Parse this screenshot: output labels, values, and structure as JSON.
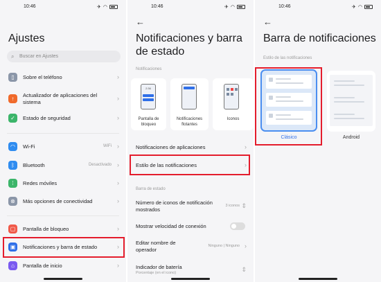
{
  "status": {
    "time": "10:46",
    "battery": "85"
  },
  "colors": {
    "accent": "#2f6fe8",
    "highlight": "#e41c2c"
  },
  "screen1": {
    "title": "Ajustes",
    "search_placeholder": "Buscar en Ajustes",
    "items": [
      {
        "label": "Sobre el teléfono",
        "icon": "phone-info-icon",
        "color": "#8b96a8",
        "value": ""
      },
      {
        "label": "Actualizador de aplicaciones del sistema",
        "icon": "update-arrow-icon",
        "color": "#f06a2b",
        "value": ""
      },
      {
        "label": "Estado de seguridad",
        "icon": "shield-check-icon",
        "color": "#3cb56a",
        "value": ""
      },
      {
        "label": "Wi-Fi",
        "icon": "wifi-icon",
        "color": "#2f8cf0",
        "value": "WiFi"
      },
      {
        "label": "Bluetooth",
        "icon": "bluetooth-icon",
        "color": "#2f8cf0",
        "value": "Desactivado"
      },
      {
        "label": "Redes móviles",
        "icon": "mobile-network-icon",
        "color": "#3cb56a",
        "value": ""
      },
      {
        "label": "Más opciones de conectividad",
        "icon": "connectivity-icon",
        "color": "#8b96a8",
        "value": ""
      },
      {
        "label": "Pantalla de bloqueo",
        "icon": "lock-screen-icon",
        "color": "#f05a4a",
        "value": ""
      },
      {
        "label": "Notificaciones y barra de estado",
        "icon": "notification-icon",
        "color": "#2f6fe8",
        "value": ""
      },
      {
        "label": "Pantalla de inicio",
        "icon": "home-screen-icon",
        "color": "#7a5af0",
        "value": ""
      }
    ]
  },
  "screen2": {
    "title": "Notificaciones y barra de estado",
    "section_notif": "Notificaciones",
    "cards": [
      {
        "label": "Pantalla de bloqueo"
      },
      {
        "label": "Notificaciones flotantes"
      },
      {
        "label": "Iconos"
      }
    ],
    "lock_card_time": "2:36",
    "row_apps": "Notificaciones de aplicaciones",
    "row_style": "Estilo de las notificaciones",
    "section_status": "Barra de estado",
    "row_icons": "Número de iconos de notificación mostrados",
    "row_icons_value": "3 iconos",
    "row_speed": "Mostrar velocidad de conexión",
    "row_operator": "Editar nombre de operador",
    "row_operator_value": "Ninguno | Ninguno",
    "row_battery": "Indicador de batería",
    "row_battery_sub": "Porcentaje (en el icono)"
  },
  "screen3": {
    "title": "Barra de notificaciones",
    "section": "Estilo de las notificaciones",
    "option_classic": "Clásico",
    "option_android": "Android"
  }
}
